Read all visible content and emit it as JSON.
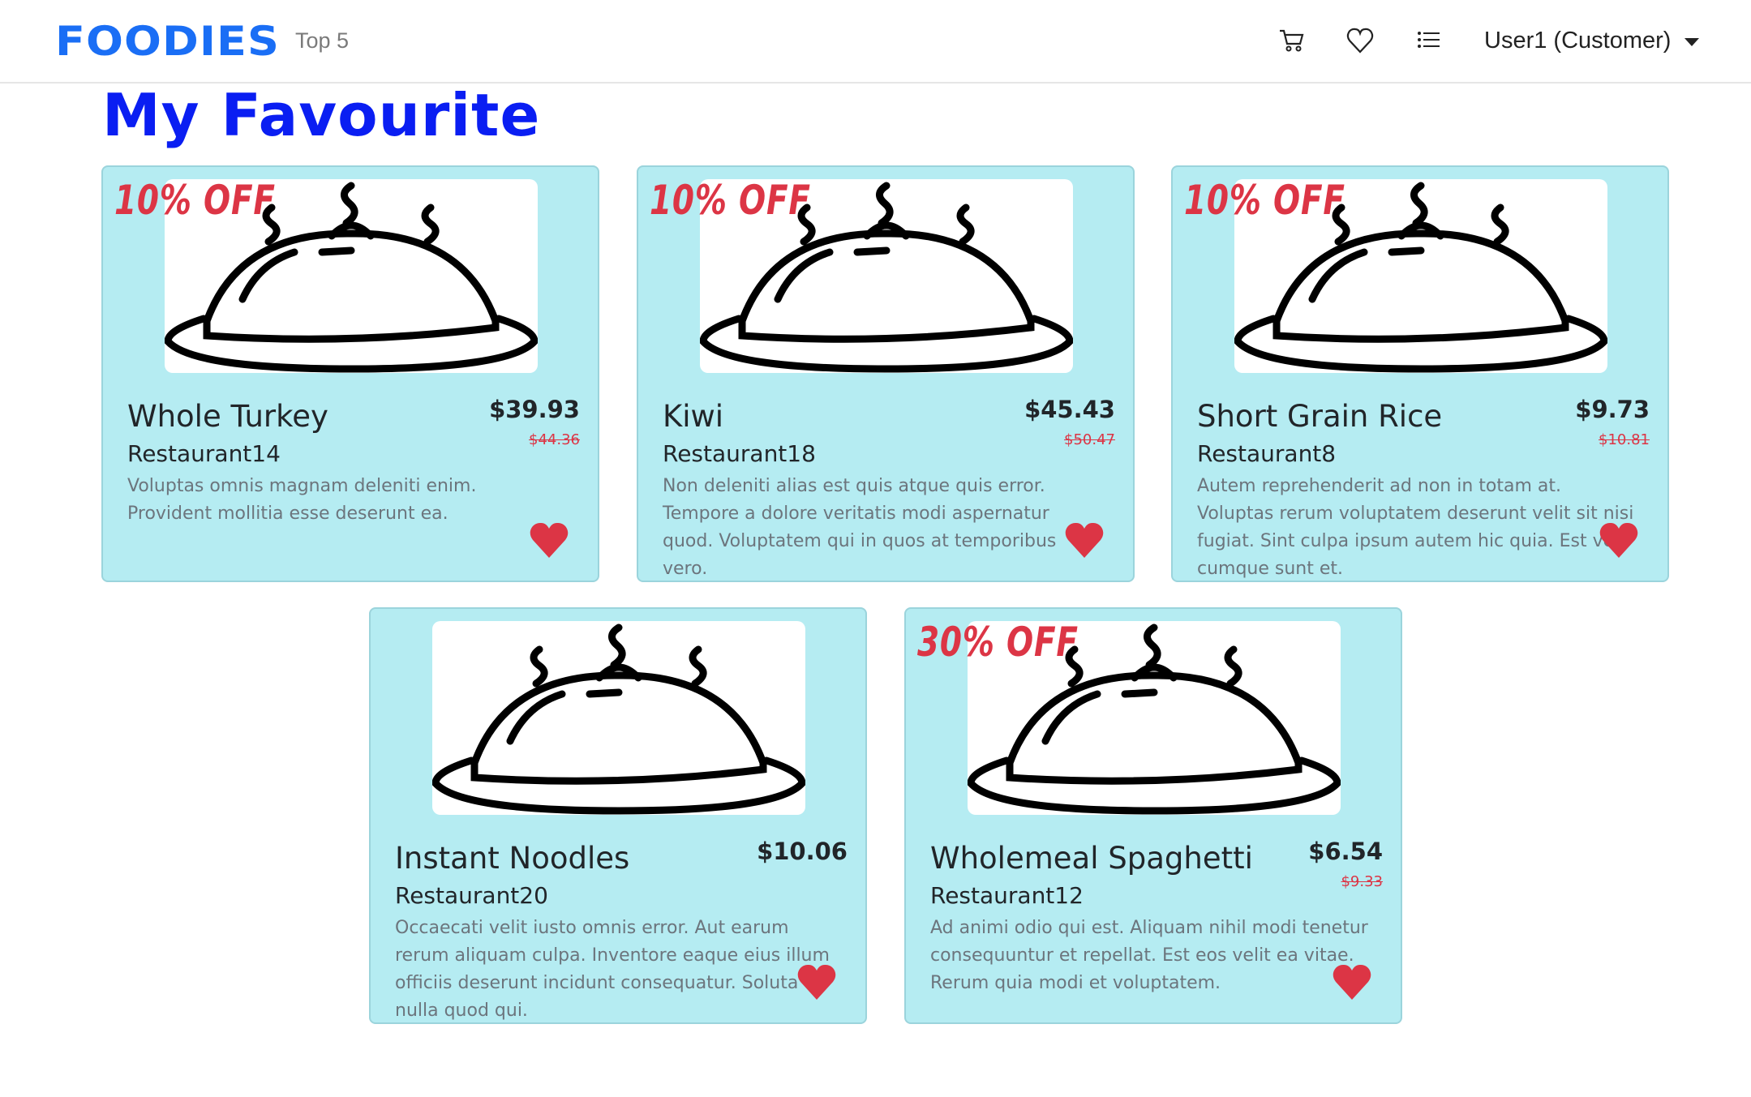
{
  "nav": {
    "logo": "FOODIES",
    "top_link": "Top 5",
    "user_menu": "User1 (Customer)",
    "icons": [
      "cart-icon",
      "heart-icon",
      "list-icon"
    ]
  },
  "page_title": "My Favourite",
  "colors": {
    "card_bg": "#b5ecf2",
    "accent": "#dc3545",
    "title": "#0a1ef2",
    "logo": "#1a6ef5"
  },
  "items": [
    {
      "badge": "10% OFF",
      "name": "Whole Turkey",
      "restaurant": "Restaurant14",
      "price": "$39.93",
      "old_price": "$44.36",
      "description": "Voluptas omnis magnam deleniti enim. Provident mollitia esse deserunt ea."
    },
    {
      "badge": "10% OFF",
      "name": "Kiwi",
      "restaurant": "Restaurant18",
      "price": "$45.43",
      "old_price": "$50.47",
      "description": "Non deleniti alias est quis atque quis error. Tempore a dolore veritatis modi aspernatur quod. Voluptatem qui in quos at temporibus vero."
    },
    {
      "badge": "10% OFF",
      "name": "Short Grain Rice",
      "restaurant": "Restaurant8",
      "price": "$9.73",
      "old_price": "$10.81",
      "description": "Autem reprehenderit ad non in totam at. Voluptas rerum voluptatem deserunt velit sit nisi fugiat. Sint culpa ipsum autem hic quia. Est vel cumque sunt et."
    },
    {
      "badge": null,
      "name": "Instant Noodles",
      "restaurant": "Restaurant20",
      "price": "$10.06",
      "old_price": null,
      "description": "Occaecati velit iusto omnis error. Aut earum rerum aliquam culpa. Inventore eaque eius illum officiis deserunt incidunt consequatur. Soluta nulla quod qui."
    },
    {
      "badge": "30% OFF",
      "name": "Wholemeal Spaghetti",
      "restaurant": "Restaurant12",
      "price": "$6.54",
      "old_price": "$9.33",
      "description": "Ad animi odio qui est. Aliquam nihil modi tenetur consequuntur et repellat. Est eos velit ea vitae. Rerum quia modi et voluptatem."
    }
  ]
}
